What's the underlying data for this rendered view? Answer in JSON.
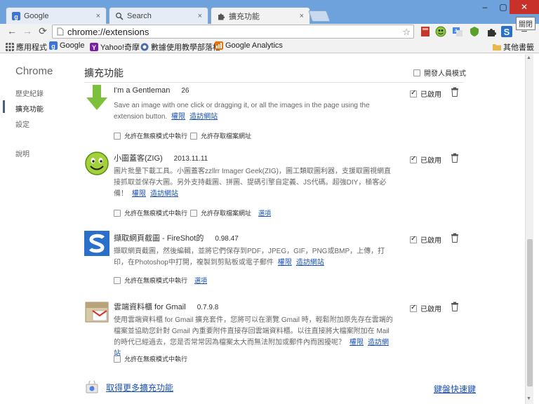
{
  "tabs": [
    {
      "label": "Google",
      "close": "×"
    },
    {
      "label": "Search",
      "close": "×"
    },
    {
      "label": "擴充功能",
      "close": "×"
    }
  ],
  "window": {
    "minimize": "–",
    "maximize": "▢",
    "close": "✕",
    "tooltip": "關閉"
  },
  "toolbar": {
    "back": "←",
    "forward": "→",
    "reload": "⟳",
    "url": "chrome://extensions",
    "star": "☆",
    "menu": "≡"
  },
  "bookmarks": [
    {
      "label": "應用程式"
    },
    {
      "label": "Google"
    },
    {
      "label": "Yahoo!奇摩"
    },
    {
      "label": "數據使用教學部落格"
    },
    {
      "label": "Google Analytics"
    }
  ],
  "other_bookmarks": "其他書籤",
  "sidebar": {
    "title": "Chrome",
    "items": [
      {
        "label": "歷史紀錄"
      },
      {
        "label": "擴充功能"
      },
      {
        "label": "設定"
      },
      {
        "label": "說明"
      }
    ]
  },
  "page": {
    "title": "擴充功能",
    "developer_mode": "開發人員模式",
    "get_more": "取得更多擴充功能",
    "shortcuts": "鍵盤快速鍵"
  },
  "extensions": [
    {
      "name": "I'm a Gentleman",
      "version": "26",
      "description": "Save an image with one click or dragging it, or all the images in the page using the extension button.",
      "links": [
        "權限",
        "造訪網站"
      ],
      "options": [
        "允許在無痕模式中執行",
        "允許存取檔案網址"
      ],
      "option_link": "",
      "enabled_label": "已啟用"
    },
    {
      "name": "小圖蓋客(ZIG)",
      "version": "2013.11.11",
      "description": "圖片批量下載工具。小圖蓋客zzllrr Imager Geek(ZIG)，圖工類取圖利器，支援取圖視網直接抓取並保存大圖。另外支持截圖、拼圖、提碼引擎自定義、JS代碼。超強DIY，極客必備！",
      "links": [
        "權限",
        "造訪網站"
      ],
      "options": [
        "允許在無痕模式中執行",
        "允許存取檔案網址"
      ],
      "option_link": "選項",
      "enabled_label": "已啟用"
    },
    {
      "name": "擷取網頁截圖 - FireShot的",
      "version": "0.98.47",
      "description": "擷取網頁截圖，然後編輯，並將它們保存到PDF，JPEG，GIF，PNG或BMP，上傳，打印，在Photoshop中打開，複製到剪貼板或電子郵件",
      "links": [
        "權限",
        "造訪網站"
      ],
      "options": [
        "允許在無痕模式中執行"
      ],
      "option_link": "選項",
      "enabled_label": "已啟用"
    },
    {
      "name": "雲端資料櫃 for Gmail",
      "version": "0.7.9.8",
      "description": "使用雲端資料櫃 for Gmail 擴充套件，您將可以在瀏覽 Gmail 時，輕鬆附加原先存在雲端的檔案並協助您針對 Gmail 內重要附件直接存回雲端資料櫃。以往直接將大檔案附加在 Mail 的時代已經過去，您是否常常因為檔案太大而無法附加或郵件內而困擾呢？",
      "links": [
        "權限",
        "造訪網站"
      ],
      "options": [
        "允許在無痕模式中執行"
      ],
      "option_link": "",
      "enabled_label": "已啟用"
    }
  ]
}
